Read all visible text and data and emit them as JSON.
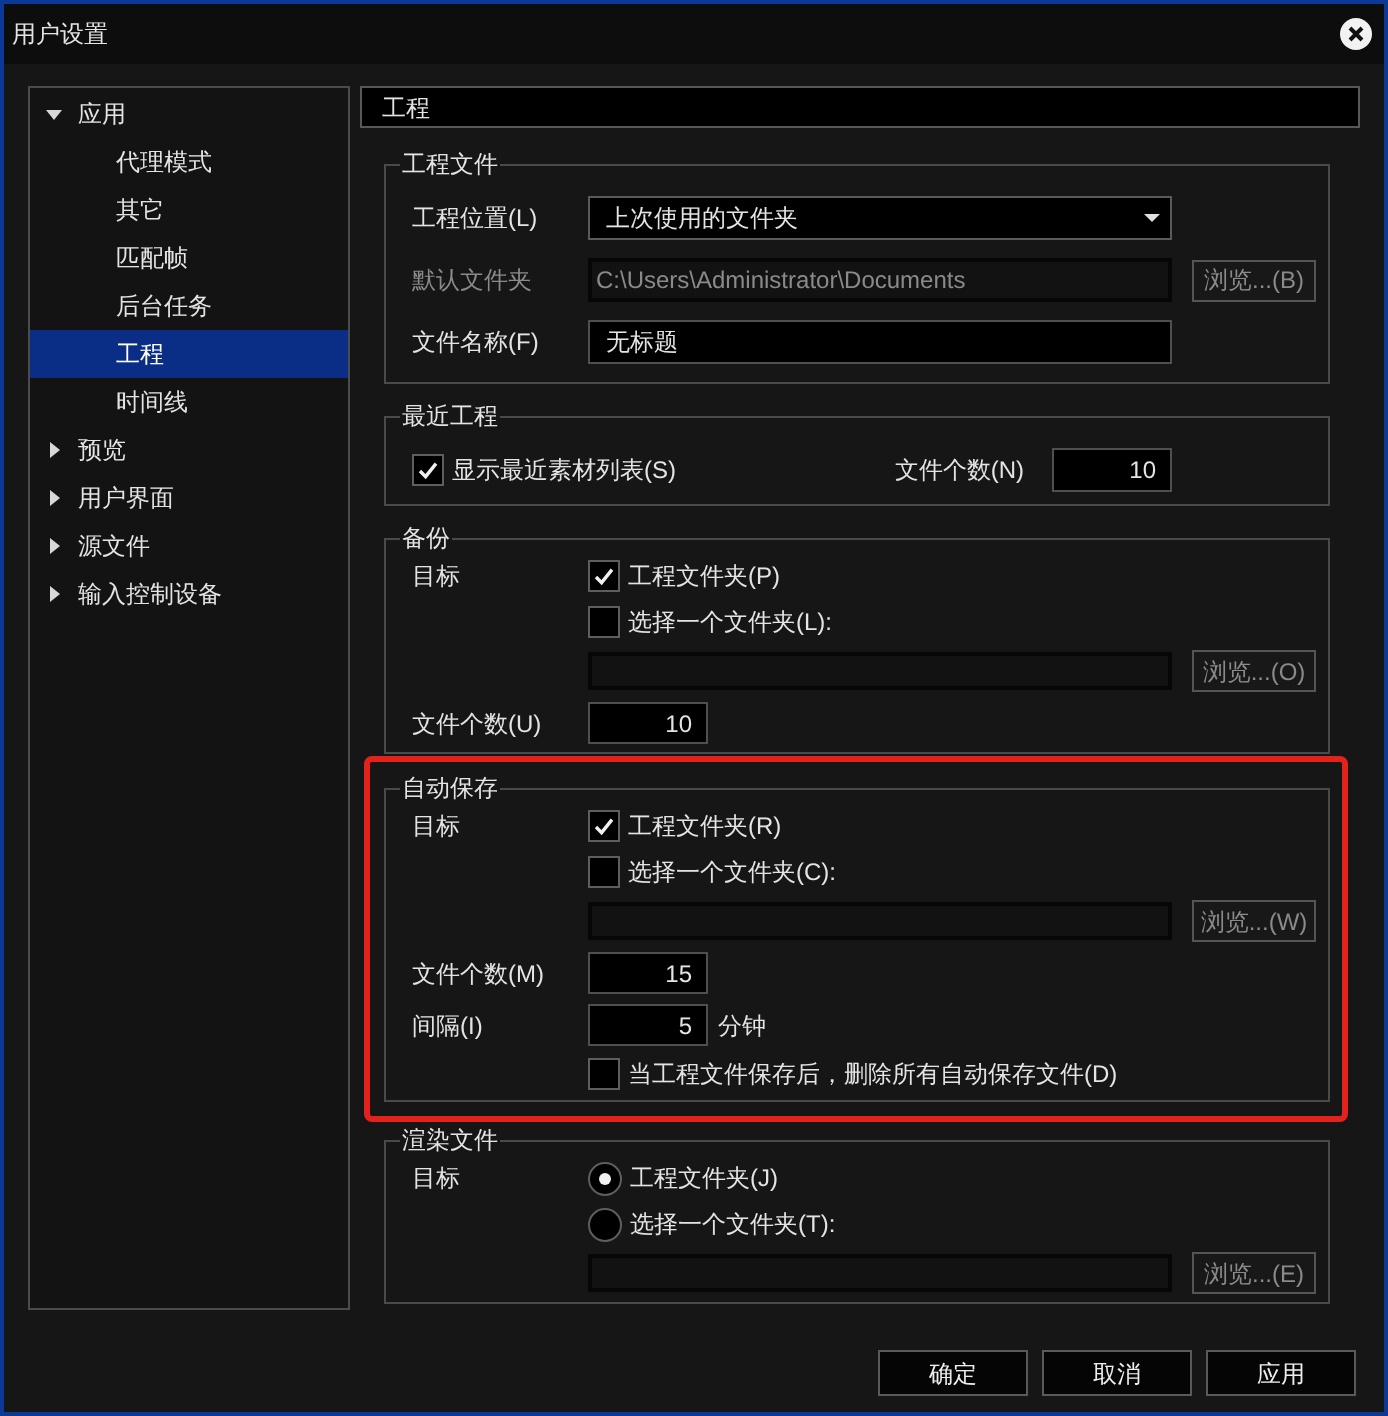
{
  "window": {
    "title": "用户设置"
  },
  "sidebar": {
    "items": [
      {
        "label": "应用",
        "expanded": true,
        "selected": false,
        "children": [
          {
            "label": "代理模式",
            "selected": false
          },
          {
            "label": "其它",
            "selected": false
          },
          {
            "label": "匹配帧",
            "selected": false
          },
          {
            "label": "后台任务",
            "selected": false
          },
          {
            "label": "工程",
            "selected": true
          },
          {
            "label": "时间线",
            "selected": false
          }
        ]
      },
      {
        "label": "预览",
        "expanded": false,
        "selected": false
      },
      {
        "label": "用户界面",
        "expanded": false,
        "selected": false
      },
      {
        "label": "源文件",
        "expanded": false,
        "selected": false
      },
      {
        "label": "输入控制设备",
        "expanded": false,
        "selected": false
      }
    ]
  },
  "page": {
    "title": "工程"
  },
  "groups": [
    {
      "title": "工程文件",
      "highlighted": false,
      "rows": [
        {
          "kind": "dropdown",
          "label": "工程位置(L)",
          "value": "上次使用的文件夹"
        },
        {
          "kind": "field",
          "label": "默认文件夹",
          "value": "C:\\Users\\Administrator\\Documents",
          "disabled": true,
          "button": "浏览...(B)"
        },
        {
          "kind": "field",
          "label": "文件名称(F)",
          "value": "无标题",
          "disabled": false
        }
      ]
    },
    {
      "title": "最近工程",
      "highlighted": false,
      "rows": [
        {
          "kind": "check-count",
          "option": "显示最近素材列表(S)",
          "checked": true,
          "count_label": "文件个数(N)",
          "count": "10"
        }
      ]
    },
    {
      "title": "备份",
      "highlighted": false,
      "rows": [
        {
          "kind": "checkbox",
          "label": "目标",
          "option": "工程文件夹(P)",
          "checked": true
        },
        {
          "kind": "checkbox",
          "option": "选择一个文件夹(L):",
          "checked": false
        },
        {
          "kind": "field",
          "disabled": true,
          "button": "浏览...(O)"
        },
        {
          "kind": "number",
          "label": "文件个数(U)",
          "value": "10"
        }
      ]
    },
    {
      "title": "自动保存",
      "highlighted": true,
      "rows": [
        {
          "kind": "checkbox",
          "label": "目标",
          "option": "工程文件夹(R)",
          "checked": true
        },
        {
          "kind": "checkbox",
          "option": "选择一个文件夹(C):",
          "checked": false
        },
        {
          "kind": "field",
          "disabled": true,
          "button": "浏览...(W)"
        },
        {
          "kind": "number",
          "label": "文件个数(M)",
          "value": "15"
        },
        {
          "kind": "number",
          "label": "间隔(I)",
          "value": "5",
          "unit": "分钟"
        },
        {
          "kind": "checkbox",
          "option": "当工程文件保存后，删除所有自动保存文件(D)",
          "checked": false
        }
      ]
    },
    {
      "title": "渲染文件",
      "highlighted": false,
      "rows": [
        {
          "kind": "radio",
          "label": "目标",
          "option": "工程文件夹(J)",
          "selected": true
        },
        {
          "kind": "radio",
          "option": "选择一个文件夹(T):",
          "selected": false
        },
        {
          "kind": "field",
          "disabled": true,
          "button": "浏览...(E)"
        }
      ]
    }
  ],
  "buttons": [
    {
      "label": "确定"
    },
    {
      "label": "取消"
    },
    {
      "label": "应用"
    }
  ]
}
